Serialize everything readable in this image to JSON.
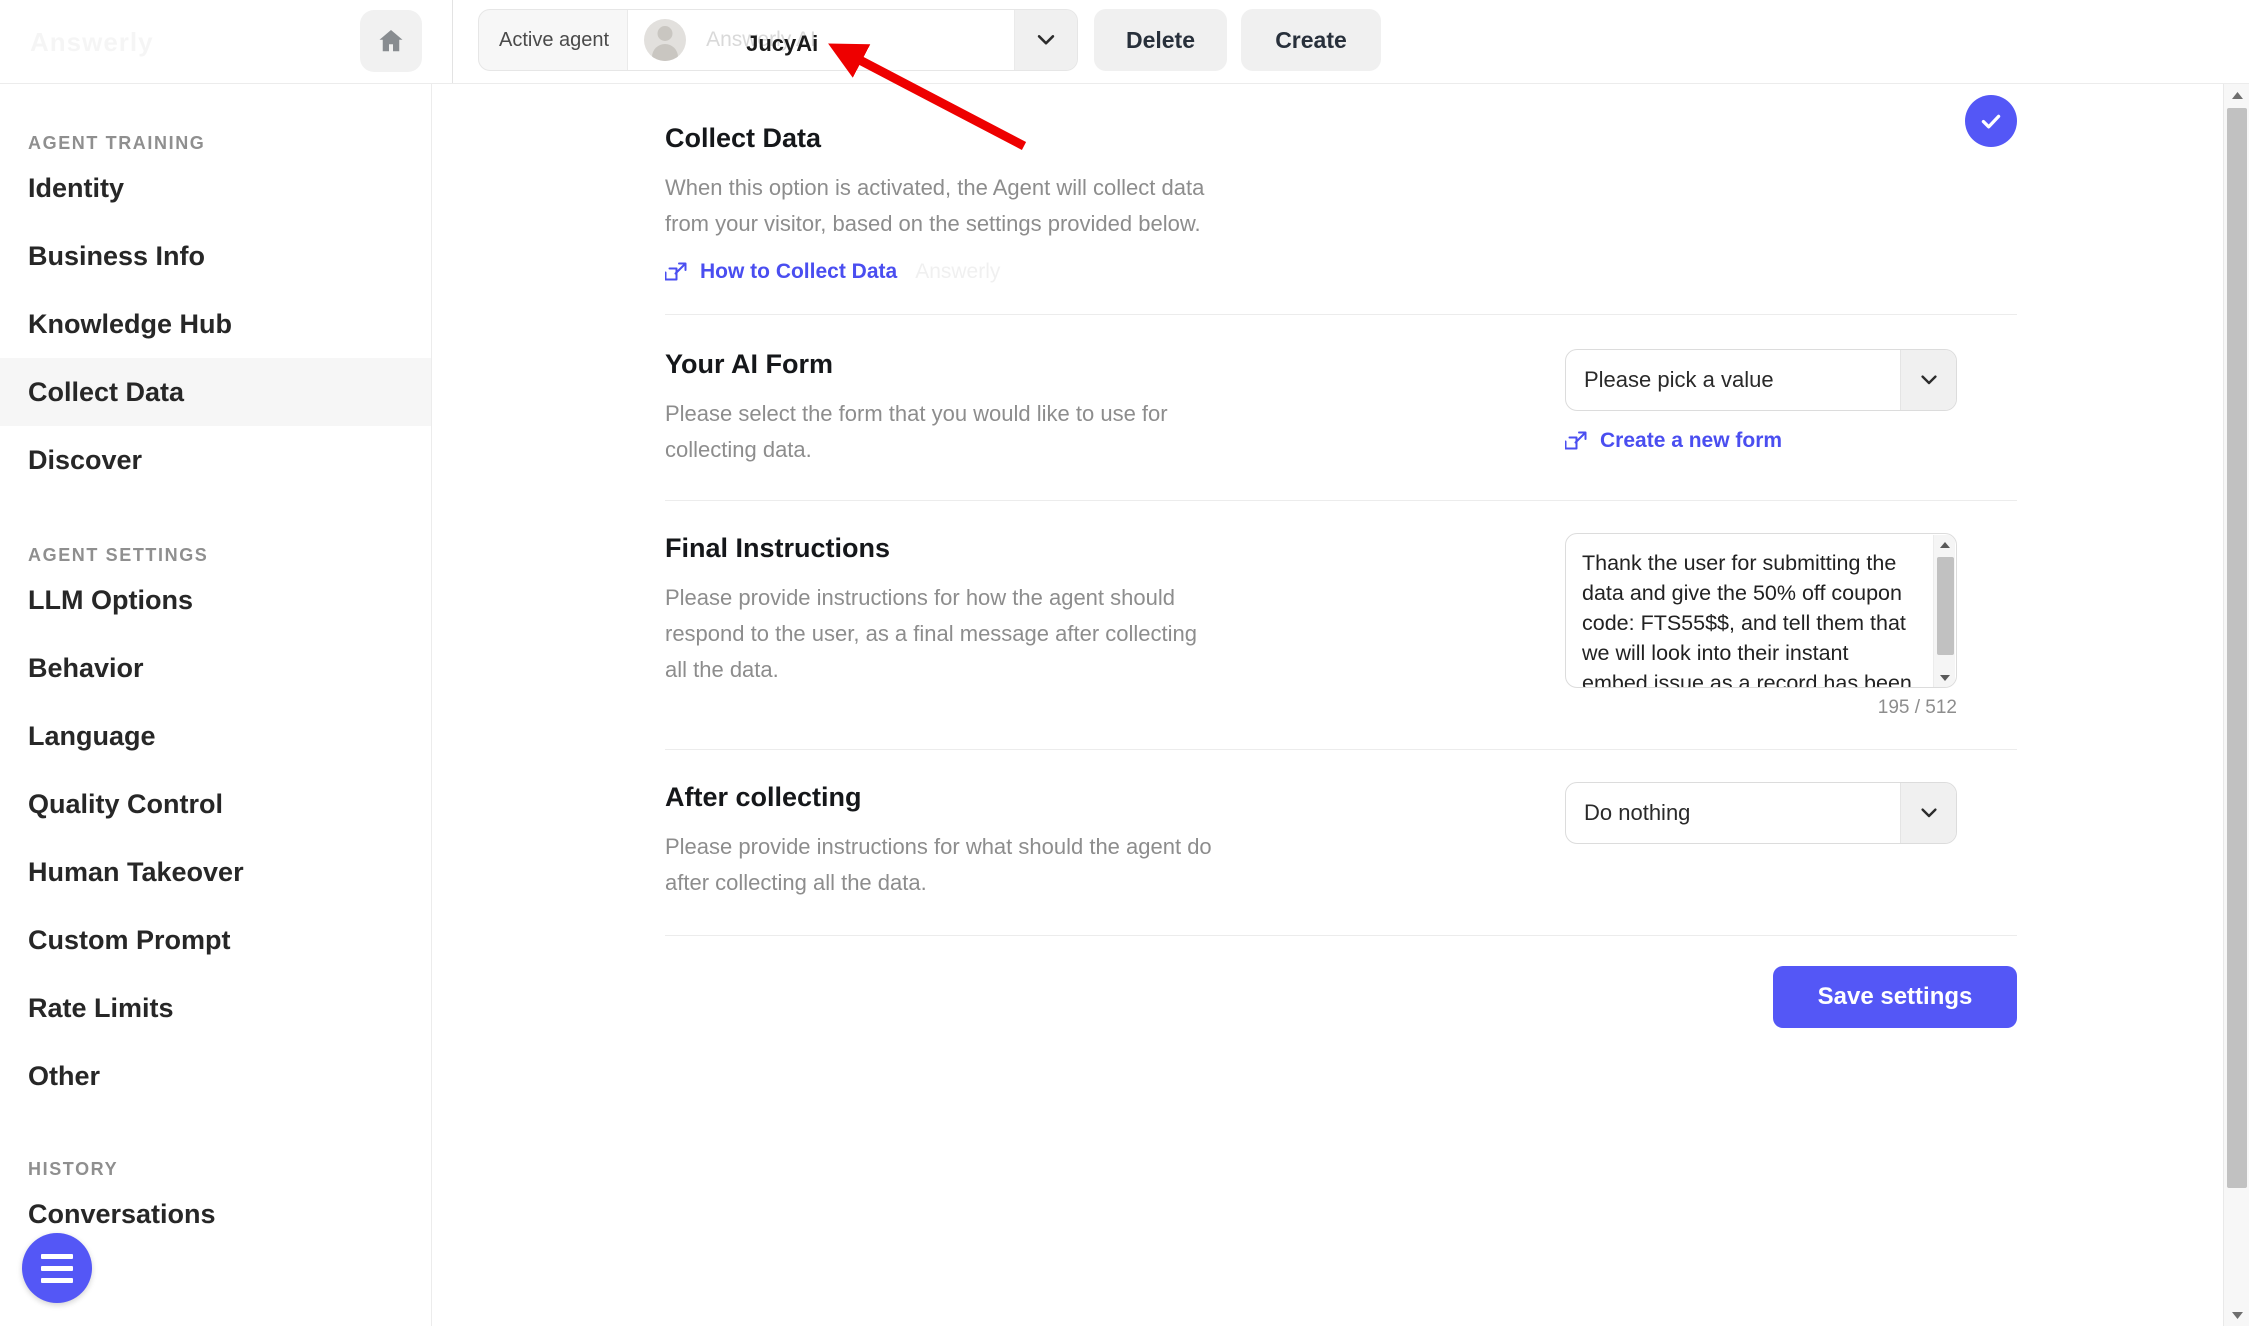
{
  "topbar": {
    "brand_watermark": "Answerly",
    "home_icon": "home-icon",
    "agent_selector": {
      "label": "Active agent",
      "ghost_value": "Answerly AI",
      "value": "JucyAi",
      "caret_icon": "chevron-down-icon",
      "avatar_icon": "user-avatar-icon"
    },
    "delete_label": "Delete",
    "create_label": "Create"
  },
  "sidebar": {
    "groups": [
      {
        "title": "AGENT TRAINING",
        "items": [
          {
            "label": "Identity",
            "active": false
          },
          {
            "label": "Business Info",
            "active": false
          },
          {
            "label": "Knowledge Hub",
            "active": false
          },
          {
            "label": "Collect Data",
            "active": true
          },
          {
            "label": "Discover",
            "active": false
          }
        ]
      },
      {
        "title": "AGENT SETTINGS",
        "items": [
          {
            "label": "LLM Options",
            "active": false
          },
          {
            "label": "Behavior",
            "active": false
          },
          {
            "label": "Language",
            "active": false
          },
          {
            "label": "Quality Control",
            "active": false
          },
          {
            "label": "Human Takeover",
            "active": false
          },
          {
            "label": "Custom Prompt",
            "active": false
          },
          {
            "label": "Rate Limits",
            "active": false
          },
          {
            "label": "Other",
            "active": false
          }
        ]
      },
      {
        "title": "HISTORY",
        "items": [
          {
            "label": "Conversations",
            "active": false
          }
        ]
      }
    ],
    "fab_icon": "hamburger-menu-icon",
    "scrollbar_up_icon": "scroll-up-arrow-icon",
    "scrollbar_down_icon": "scroll-down-arrow-icon"
  },
  "main": {
    "collect_data": {
      "title": "Collect Data",
      "description": "When this option is activated, the Agent will collect data from your visitor, based on the settings provided below.",
      "link_label": "How to Collect Data",
      "link_icon": "external-link-icon",
      "watermark": "Answerly",
      "toggle_state_icon": "check-icon",
      "toggle_enabled": "true"
    },
    "ai_form": {
      "title": "Your AI Form",
      "description": "Please select the form that you would like to use for collecting data.",
      "select_value": "Please pick a value",
      "select_caret_icon": "chevron-down-icon",
      "link_label": "Create a new form",
      "link_icon": "external-link-icon"
    },
    "final_instructions": {
      "title": "Final Instructions",
      "description": "Please provide instructions for how the agent should respond to the user, as a final message after collecting all the data.",
      "textarea_value": "Thank the user for submitting the data and give the 50% off coupon code: FTS55$$, and tell them that we will look into their instant embed issue as a record has been created in their ip address",
      "char_counter": "195 / 512",
      "scroll_up_icon": "scroll-up-arrow-icon",
      "scroll_down_icon": "scroll-down-arrow-icon"
    },
    "after_collecting": {
      "title": "After collecting",
      "description": "Please provide instructions for what should the agent do after collecting all the data.",
      "select_value": "Do nothing",
      "select_caret_icon": "chevron-down-icon"
    },
    "save_label": "Save settings"
  },
  "annotation": {
    "arrow_color": "#ee0000",
    "arrow_points_to": "JucyAi"
  },
  "colors": {
    "accent": "#5457f6",
    "link": "#4a4ef0",
    "text": "#15171a",
    "muted": "#8d8d8d",
    "panel": "#f0f0f0",
    "highlight": "#f6f6f6"
  }
}
